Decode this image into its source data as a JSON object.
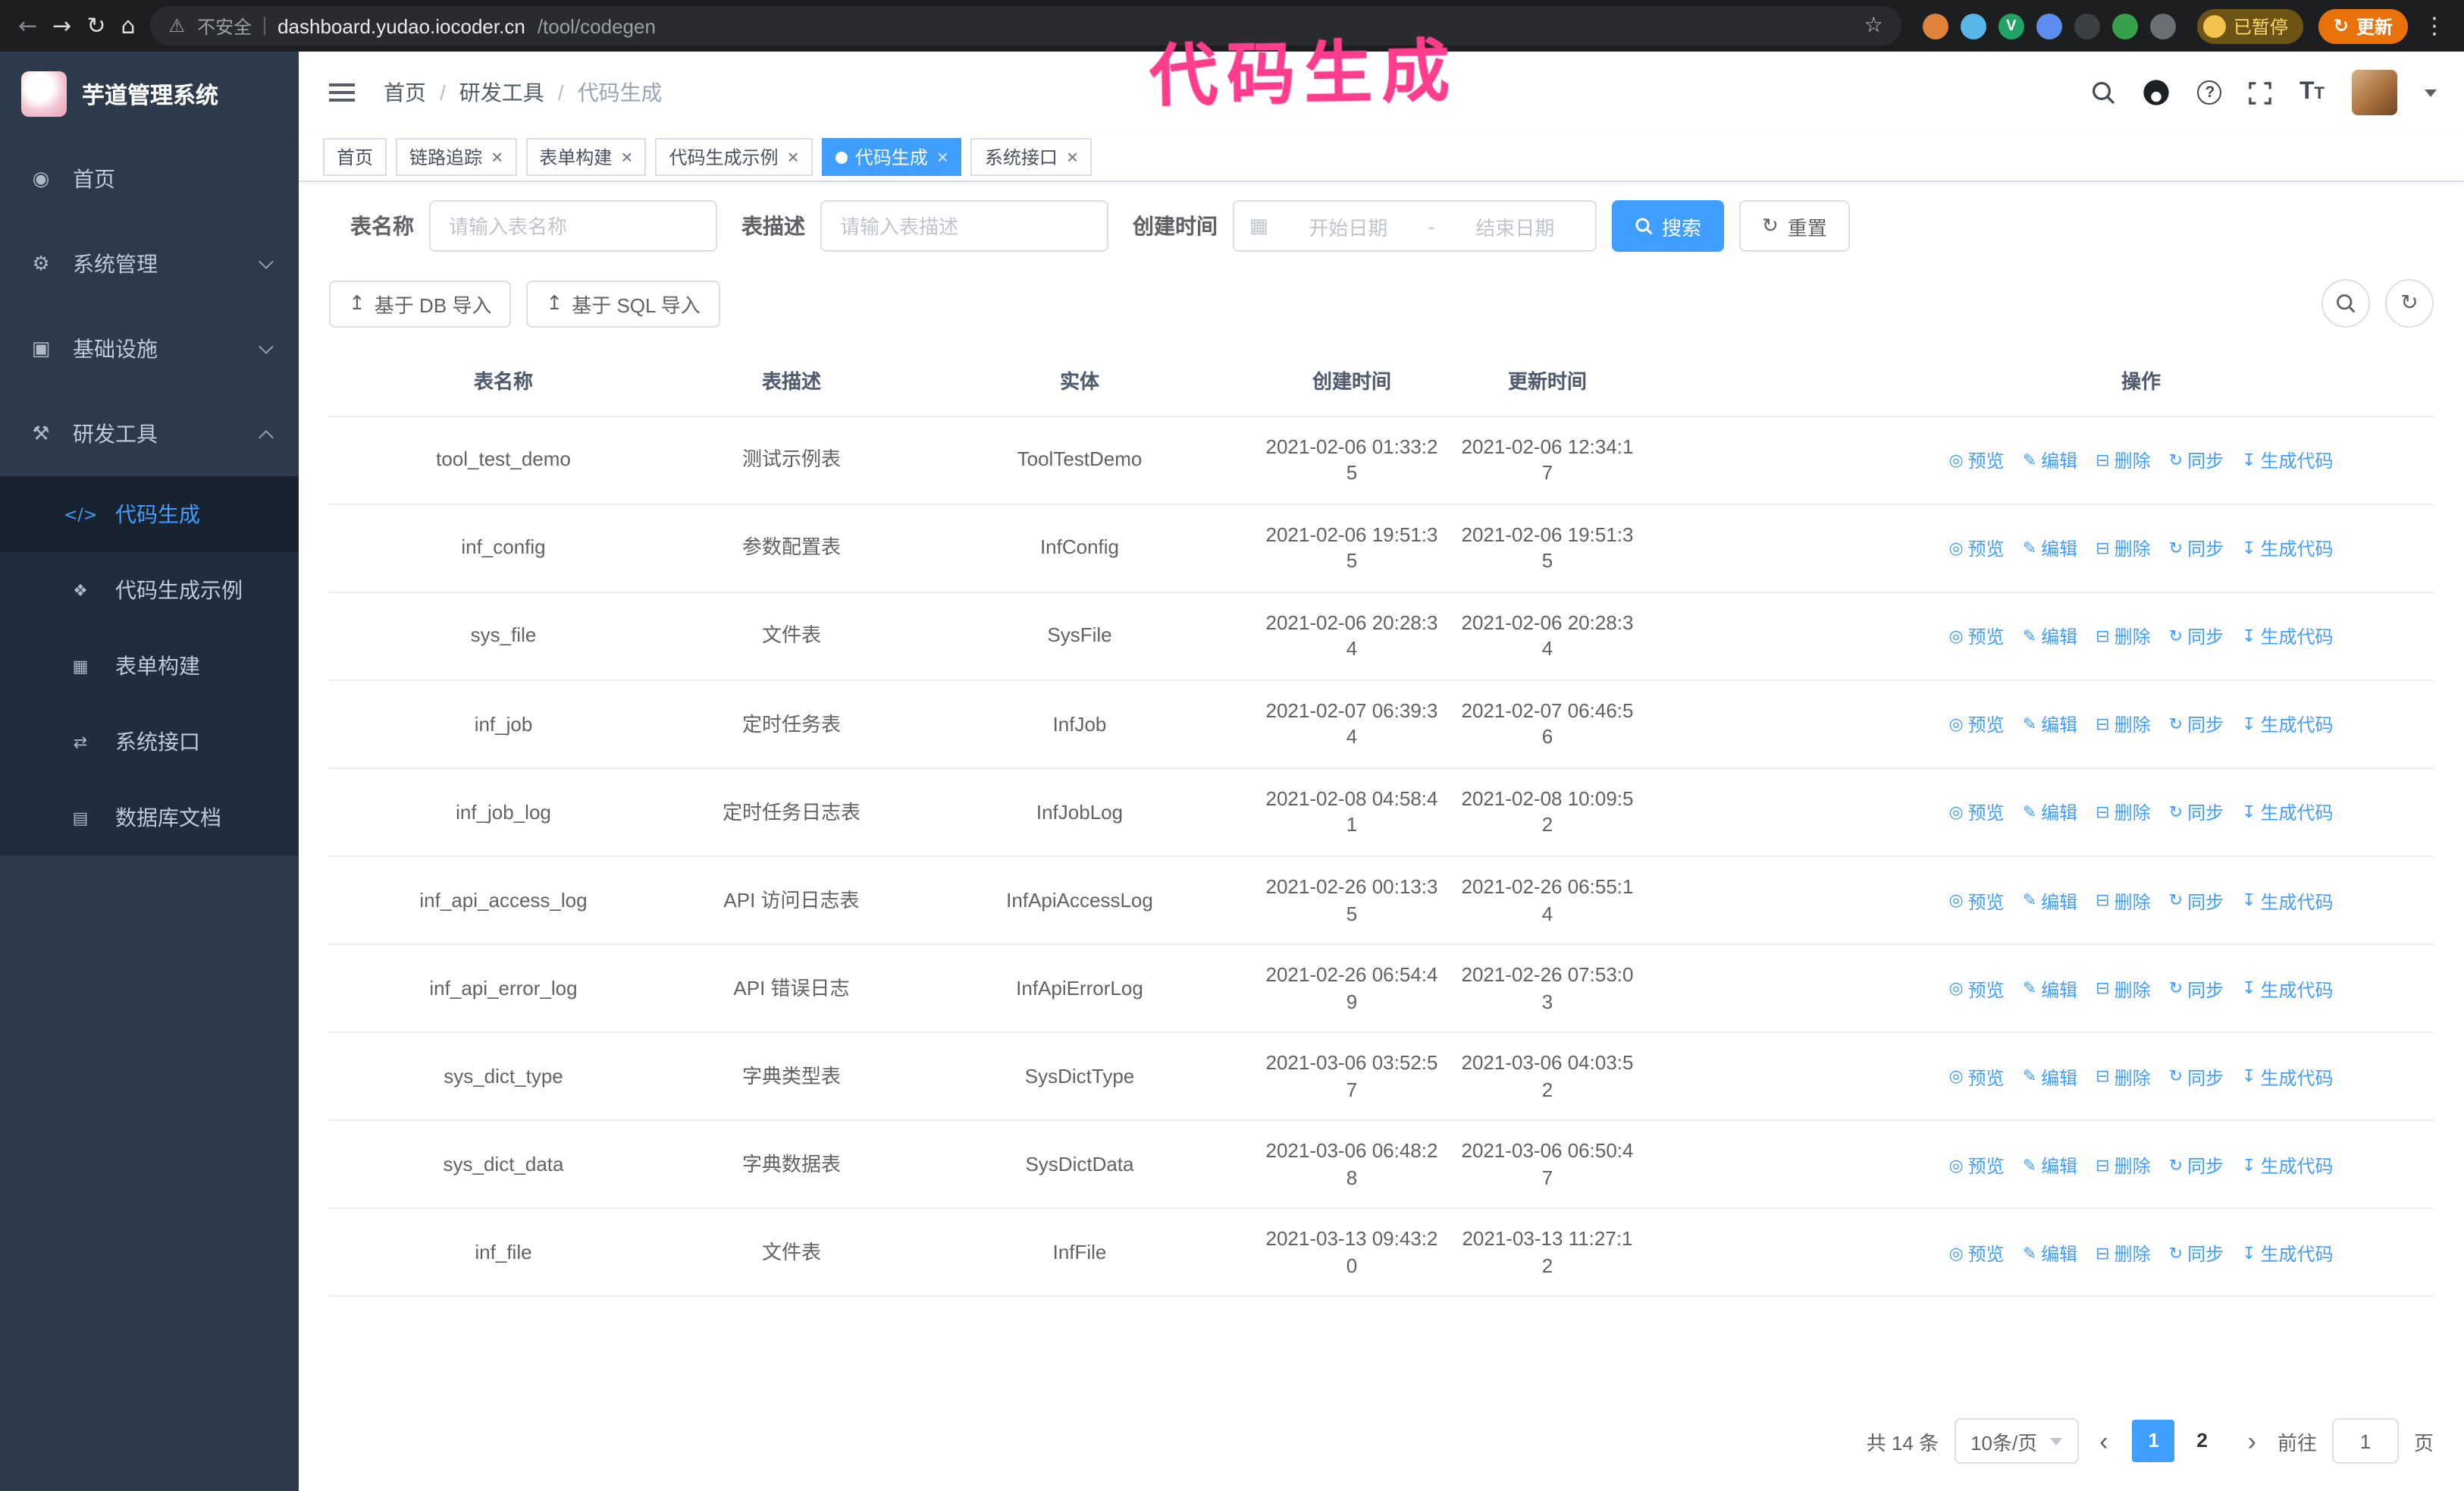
{
  "colors": {
    "primary": "#409eff",
    "sidebar_bg": "#2d3a4b",
    "submenu_bg": "#1f2d3d",
    "annotation_pink": "#ff3d8c",
    "update_button_orange": "#e8710a"
  },
  "browser": {
    "security_label": "不安全",
    "url_host": "dashboard.yudao.iocoder.cn",
    "url_path": "/tool/codegen",
    "paused_label": "已暂停",
    "update_label": "更新",
    "extensions": [
      {
        "id": "ext-1",
        "color": "#e0823a"
      },
      {
        "id": "ext-2",
        "color": "#58b6e8"
      },
      {
        "id": "ext-3",
        "color": "#21a366",
        "letter": "V"
      },
      {
        "id": "ext-4",
        "color": "#5b8def"
      },
      {
        "id": "ext-5",
        "color": "#3d4043"
      },
      {
        "id": "ext-6",
        "color": "#37a04a"
      },
      {
        "id": "ext-7",
        "color": "#6b6e73"
      }
    ]
  },
  "annotation": {
    "text": "代码生成"
  },
  "sidebar": {
    "app_title": "芋道管理系统",
    "menu": [
      {
        "id": "home",
        "label": "首页",
        "icon": "dashboard"
      },
      {
        "id": "system",
        "label": "系统管理",
        "icon": "gear",
        "chevron": "down"
      },
      {
        "id": "infra",
        "label": "基础设施",
        "icon": "infra",
        "chevron": "down"
      },
      {
        "id": "devtools",
        "label": "研发工具",
        "icon": "tools",
        "chevron": "up",
        "children": [
          {
            "id": "codegen",
            "label": "代码生成",
            "icon": "code",
            "active": true
          },
          {
            "id": "codegen-example",
            "label": "代码生成示例",
            "icon": "example"
          },
          {
            "id": "form-builder",
            "label": "表单构建",
            "icon": "form"
          },
          {
            "id": "system-api",
            "label": "系统接口",
            "icon": "api"
          },
          {
            "id": "db-doc",
            "label": "数据库文档",
            "icon": "db"
          }
        ]
      }
    ]
  },
  "header": {
    "breadcrumb": [
      "首页",
      "研发工具",
      "代码生成"
    ]
  },
  "tabs": [
    {
      "id": "home",
      "label": "首页",
      "closable": false,
      "active": false
    },
    {
      "id": "tracing",
      "label": "链路追踪",
      "closable": true,
      "active": false
    },
    {
      "id": "form-builder",
      "label": "表单构建",
      "closable": true,
      "active": false
    },
    {
      "id": "codegen-example",
      "label": "代码生成示例",
      "closable": true,
      "active": false
    },
    {
      "id": "codegen",
      "label": "代码生成",
      "closable": true,
      "active": true
    },
    {
      "id": "system-api",
      "label": "系统接口",
      "closable": true,
      "active": false
    }
  ],
  "filters": {
    "table_name_label": "表名称",
    "table_name_placeholder": "请输入表名称",
    "table_desc_label": "表描述",
    "table_desc_placeholder": "请输入表描述",
    "create_time_label": "创建时间",
    "date_start_placeholder": "开始日期",
    "date_separator": "-",
    "date_end_placeholder": "结束日期",
    "search_button": "搜索",
    "reset_button": "重置"
  },
  "toolbar": {
    "import_db": "基于 DB 导入",
    "import_sql": "基于 SQL 导入"
  },
  "table": {
    "columns": [
      "表名称",
      "表描述",
      "实体",
      "创建时间",
      "更新时间",
      "操作"
    ],
    "actions": [
      {
        "id": "preview",
        "label": "预览",
        "icon": "eye"
      },
      {
        "id": "edit",
        "label": "编辑",
        "icon": "edit"
      },
      {
        "id": "delete",
        "label": "删除",
        "icon": "del"
      },
      {
        "id": "sync",
        "label": "同步",
        "icon": "sync"
      },
      {
        "id": "generate",
        "label": "生成代码",
        "icon": "gen"
      }
    ],
    "rows": [
      {
        "name": "tool_test_demo",
        "desc": "测试示例表",
        "entity": "ToolTestDemo",
        "created": "2021-02-06 01:33:25",
        "updated": "2021-02-06 12:34:17"
      },
      {
        "name": "inf_config",
        "desc": "参数配置表",
        "entity": "InfConfig",
        "created": "2021-02-06 19:51:35",
        "updated": "2021-02-06 19:51:35"
      },
      {
        "name": "sys_file",
        "desc": "文件表",
        "entity": "SysFile",
        "created": "2021-02-06 20:28:34",
        "updated": "2021-02-06 20:28:34"
      },
      {
        "name": "inf_job",
        "desc": "定时任务表",
        "entity": "InfJob",
        "created": "2021-02-07 06:39:34",
        "updated": "2021-02-07 06:46:56"
      },
      {
        "name": "inf_job_log",
        "desc": "定时任务日志表",
        "entity": "InfJobLog",
        "created": "2021-02-08 04:58:41",
        "updated": "2021-02-08 10:09:52"
      },
      {
        "name": "inf_api_access_log",
        "desc": "API 访问日志表",
        "entity": "InfApiAccessLog",
        "created": "2021-02-26 00:13:35",
        "updated": "2021-02-26 06:55:14"
      },
      {
        "name": "inf_api_error_log",
        "desc": "API 错误日志",
        "entity": "InfApiErrorLog",
        "created": "2021-02-26 06:54:49",
        "updated": "2021-02-26 07:53:03"
      },
      {
        "name": "sys_dict_type",
        "desc": "字典类型表",
        "entity": "SysDictType",
        "created": "2021-03-06 03:52:57",
        "updated": "2021-03-06 04:03:52"
      },
      {
        "name": "sys_dict_data",
        "desc": "字典数据表",
        "entity": "SysDictData",
        "created": "2021-03-06 06:48:28",
        "updated": "2021-03-06 06:50:47"
      },
      {
        "name": "inf_file",
        "desc": "文件表",
        "entity": "InfFile",
        "created": "2021-03-13 09:43:20",
        "updated": "2021-03-13 11:27:12"
      }
    ]
  },
  "pagination": {
    "total_text": "共 14 条",
    "page_size_text": "10条/页",
    "pages": [
      "1",
      "2"
    ],
    "active_page": "1",
    "goto_label": "前往",
    "goto_value": "1",
    "unit_label": "页"
  }
}
